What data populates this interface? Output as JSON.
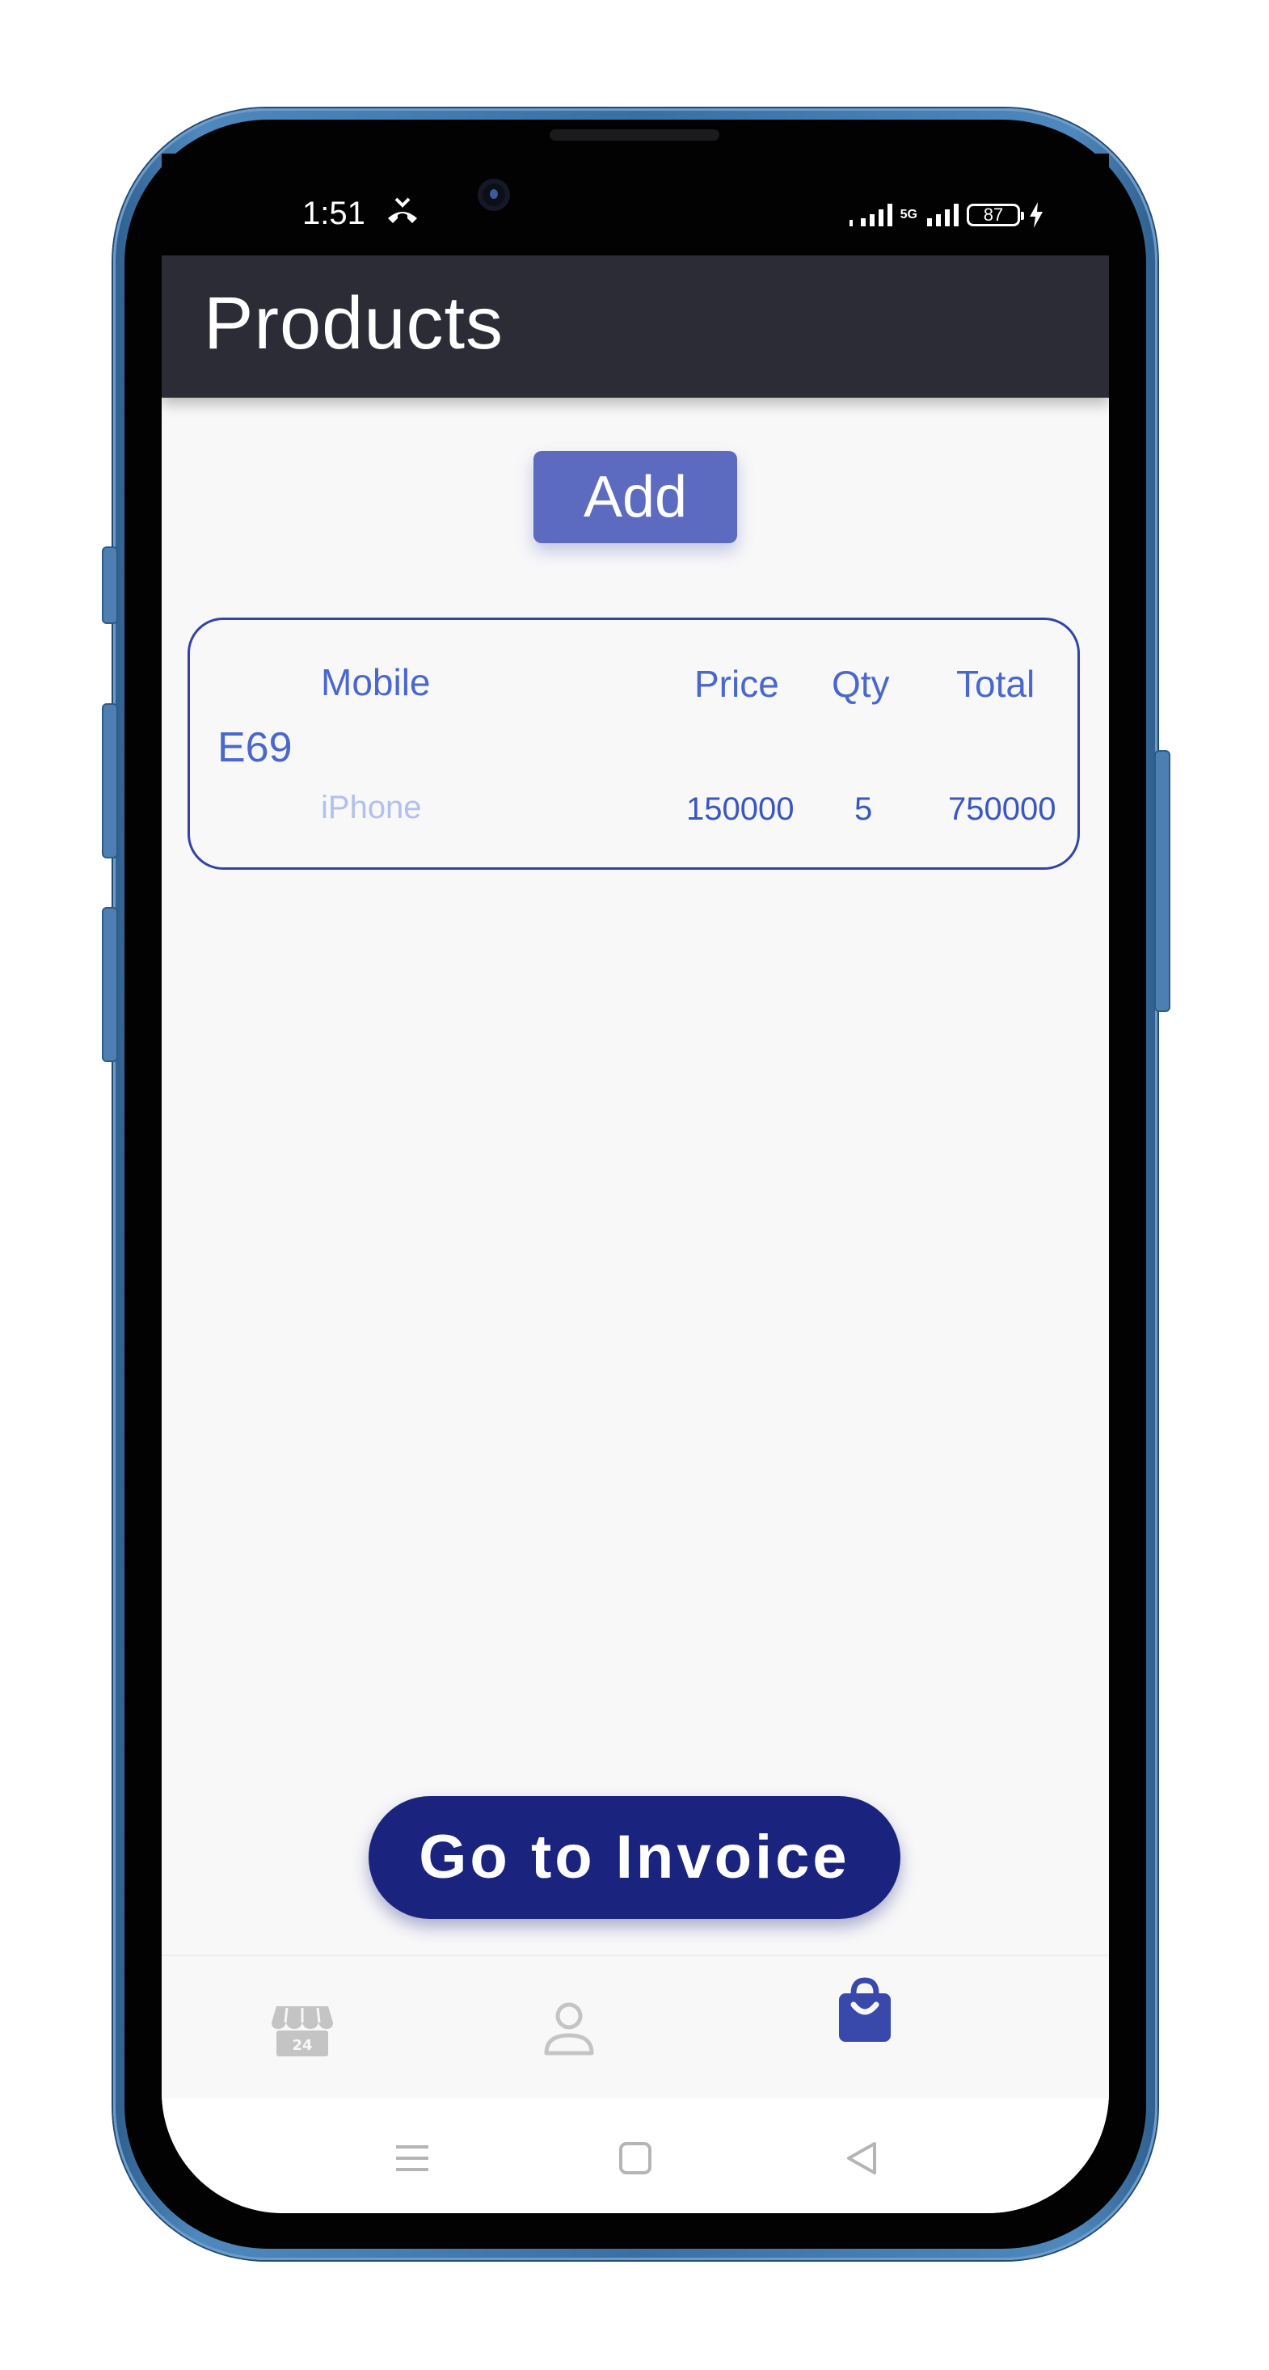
{
  "status_bar": {
    "time": "1:51",
    "network": "5G",
    "battery": "87"
  },
  "app_bar": {
    "title": "Products"
  },
  "actions": {
    "add_label": "Add",
    "invoice_label": "Go to Invoice"
  },
  "product_card": {
    "code": "E69",
    "headers": {
      "name": "Mobile",
      "price": "Price",
      "qty": "Qty",
      "total": "Total"
    },
    "row": {
      "name": "iPhone",
      "price": "150000",
      "qty": "5",
      "total": "750000"
    }
  },
  "bottom_nav": {
    "items": [
      {
        "icon": "store-24-icon",
        "active": false
      },
      {
        "icon": "person-icon",
        "active": false
      },
      {
        "icon": "shopping-bag-icon",
        "active": true
      }
    ]
  },
  "system_nav": {
    "items": [
      "menu-icon",
      "home-icon",
      "back-icon"
    ]
  },
  "colors": {
    "app_bar": "#2b2c35",
    "add_button": "#5c6bc0",
    "invoice_button": "#1a237e",
    "card_border": "#3344a6",
    "active_nav": "#3949ab",
    "inactive_nav": "#c4c4c4"
  }
}
